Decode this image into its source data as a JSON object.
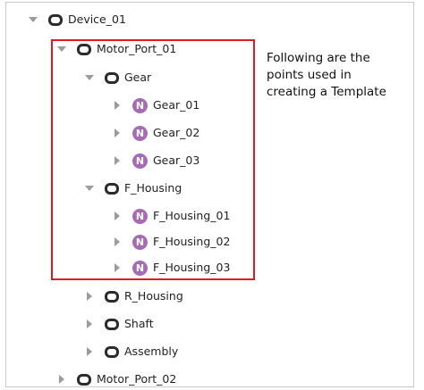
{
  "tree": {
    "items": [
      {
        "label": "Device_01",
        "state": "expanded",
        "kind": "folder"
      },
      {
        "label": "Motor_Port_01",
        "state": "expanded",
        "kind": "folder"
      },
      {
        "label": "Gear",
        "state": "expanded",
        "kind": "folder"
      },
      {
        "label": "Gear_01",
        "state": "collapsed",
        "kind": "point"
      },
      {
        "label": "Gear_02",
        "state": "collapsed",
        "kind": "point"
      },
      {
        "label": "Gear_03",
        "state": "collapsed",
        "kind": "point"
      },
      {
        "label": "F_Housing",
        "state": "expanded",
        "kind": "folder"
      },
      {
        "label": "F_Housing_01",
        "state": "collapsed",
        "kind": "point"
      },
      {
        "label": "F_Housing_02",
        "state": "collapsed",
        "kind": "point"
      },
      {
        "label": "F_Housing_03",
        "state": "collapsed",
        "kind": "point"
      },
      {
        "label": "R_Housing",
        "state": "collapsed",
        "kind": "folder"
      },
      {
        "label": "Shaft",
        "state": "collapsed",
        "kind": "folder"
      },
      {
        "label": "Assembly",
        "state": "collapsed",
        "kind": "folder"
      },
      {
        "label": "Motor_Port_02",
        "state": "collapsed",
        "kind": "folder"
      }
    ],
    "point_badge_letter": "N"
  },
  "annotation": {
    "lines": [
      "Following are the",
      "points used in",
      "creating a Template"
    ],
    "highlight_color": "#e11b22"
  },
  "colors": {
    "point_badge": "#a76bb5",
    "arrow": "#9b9b9b",
    "folder_icon": "#2b2b2b"
  }
}
